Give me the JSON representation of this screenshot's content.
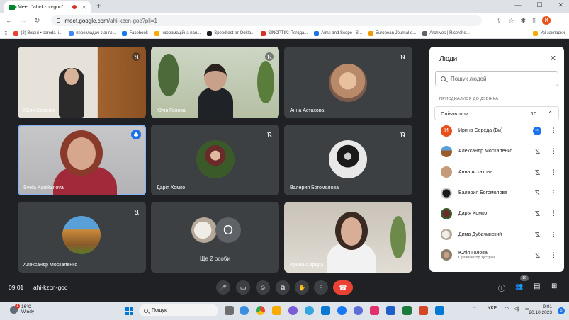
{
  "browser": {
    "tab_title": "Meet: \"ahi-kzcn-goc\"",
    "tab_close": "✕",
    "newtab": "+",
    "url_host": "meet.google.com",
    "url_path": "/ahi-kzcn-goc?pli=1",
    "back": "←",
    "forward": "→",
    "reload": "↻",
    "profile_initial": "И",
    "win_min": "—",
    "win_max": "☐",
    "win_close": "✕",
    "bookmarks": [
      {
        "label": "(2) Вхідні • sereda_i...",
        "color": "#ea4335"
      },
      {
        "label": "перекладач с англ...",
        "color": "#4285f4"
      },
      {
        "label": "Facebook",
        "color": "#1877f2"
      },
      {
        "label": "Інформаційна пан...",
        "color": "#f9ab00"
      },
      {
        "label": "Speedtest от Ookla...",
        "color": "#202124"
      },
      {
        "label": "SINOPTIK: Погода...",
        "color": "#d93025"
      },
      {
        "label": "Aims and Scope | S...",
        "color": "#1a73e8"
      },
      {
        "label": "European Journal o...",
        "color": "#f29900"
      },
      {
        "label": "Archives | Ricerche...",
        "color": "#5f6368"
      }
    ],
    "bookmarks_all": "Усі закладки"
  },
  "tiles": [
    {
      "name": "Юлія Семенів"
    },
    {
      "name": "Юлія Голова"
    },
    {
      "name": "Анна Астахова"
    },
    {
      "name": "Sveta Karskanova"
    },
    {
      "name": "Дарія Хомко"
    },
    {
      "name": "Валерия Богомолова"
    },
    {
      "name": "Александр Москаленко"
    },
    {
      "name": "Ще 2 особи",
      "initial": "O"
    },
    {
      "name": "Ирина Середа"
    }
  ],
  "panel": {
    "title": "Люди",
    "close": "✕",
    "search_placeholder": "Пошук людей",
    "section": "ПРИЄДНАЛИСЯ ДО ДЗВІНКА",
    "group_name": "Співавтори",
    "group_count": "10",
    "group_chev": "⌃",
    "people": [
      {
        "name": "Ирина Середа (Ви)",
        "initial": "И",
        "color": "#e8501a",
        "dots": "•••"
      },
      {
        "name": "Александр Москаленко",
        "color": "#9b5b2a"
      },
      {
        "name": "Анна Астахова",
        "color": "#c59a7a"
      },
      {
        "name": "Валерия Богомолова",
        "color": "#444444"
      },
      {
        "name": "Дарія Хомко",
        "color": "#5a3a2a"
      },
      {
        "name": "Дима Дубачинский",
        "color": "#d6c5b5"
      },
      {
        "name": "Юлія Голова",
        "role": "Організатор зустрічі",
        "color": "#8a7f6a"
      }
    ],
    "kebab": "⋮"
  },
  "bar": {
    "time": "09:01",
    "code": "ahi-kzcn-goc",
    "people_badge": "10",
    "mic": "🎤",
    "cam": "▭",
    "emoji": "☺",
    "present": "⧉",
    "hand": "✋",
    "more": "⋮",
    "end": "☎",
    "info": "ⓘ",
    "people": "👥",
    "chat": "▤",
    "activities": "⊞"
  },
  "taskbar": {
    "temp": "16°C",
    "weather": "Windy",
    "weather_badge": "1",
    "search": "Пошук",
    "lang": "УКР",
    "time": "9:01",
    "date": "20.10.2023",
    "notif": "5",
    "apps": [
      "#3c8ee0",
      "#6e6e6e",
      "#0f9d58",
      "#4285f4",
      "#f9ab00",
      "#7b5bd6",
      "#34a7e0",
      "#0b78d4",
      "#1877f2",
      "#5b6dd8",
      "#e1306c",
      "#33a852",
      "#1c7a3f",
      "#1d5fc6",
      "#d24726",
      "#0078d4"
    ]
  }
}
